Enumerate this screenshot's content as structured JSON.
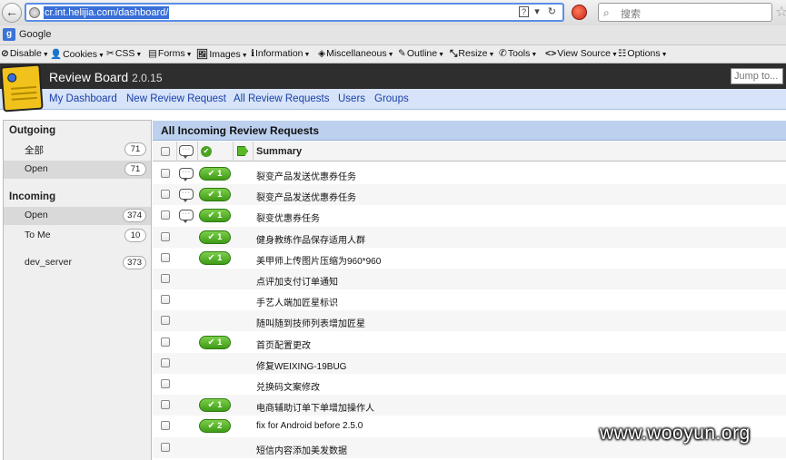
{
  "browser": {
    "url": "cr.int.helijia.com/dashboard/",
    "search_placeholder": "搜索",
    "url_tools": "▾ ↻"
  },
  "bookmarks": [
    {
      "label": "Google"
    }
  ],
  "devbar": [
    {
      "glyph": "⊘",
      "label": "Disable"
    },
    {
      "glyph": "👤",
      "label": "Cookies"
    },
    {
      "glyph": "✂",
      "label": "CSS"
    },
    {
      "glyph": "▤",
      "label": "Forms"
    },
    {
      "glyph": "🖼",
      "label": "Images"
    },
    {
      "glyph": "ℹ",
      "label": "Information"
    },
    {
      "glyph": "◈",
      "label": "Miscellaneous"
    },
    {
      "glyph": "✎",
      "label": "Outline"
    },
    {
      "glyph": "⤡",
      "label": "Resize"
    },
    {
      "glyph": "✆",
      "label": "Tools"
    },
    {
      "glyph": "<>",
      "label": "View Source"
    },
    {
      "glyph": "☷",
      "label": "Options"
    }
  ],
  "header": {
    "title": "Review Board",
    "version": "2.0.15",
    "jump_placeholder": "Jump to..."
  },
  "nav": [
    {
      "label": "My Dashboard"
    },
    {
      "label": "New Review Request"
    },
    {
      "label": "All Review Requests"
    },
    {
      "label": "Users"
    },
    {
      "label": "Groups"
    }
  ],
  "sidebar": {
    "outgoing_heading": "Outgoing",
    "outgoing": [
      {
        "label": "全部",
        "count": "71"
      },
      {
        "label": "Open",
        "count": "71"
      }
    ],
    "incoming_heading": "Incoming",
    "incoming": [
      {
        "label": "Open",
        "count": "374"
      },
      {
        "label": "To Me",
        "count": "10"
      },
      {
        "label": "dev_server",
        "count": "373"
      }
    ]
  },
  "main": {
    "title": "All Incoming Review Requests",
    "summary_header": "Summary",
    "rows": [
      {
        "comments": true,
        "ship": "✔ 1",
        "summary": "裂变产品发送优惠券任务"
      },
      {
        "comments": true,
        "ship": "✔ 1",
        "summary": "裂变产品发送优惠券任务"
      },
      {
        "comments": true,
        "ship": "✔ 1",
        "summary": "裂变优惠券任务"
      },
      {
        "comments": false,
        "ship": "✔ 1",
        "summary": "健身教练作品保存适用人群"
      },
      {
        "comments": false,
        "ship": "✔ 1",
        "summary": "美甲师上传图片压缩为960*960"
      },
      {
        "comments": false,
        "ship": "",
        "summary": "点评加支付订单通知"
      },
      {
        "comments": false,
        "ship": "",
        "summary": "手艺人端加匠星标识"
      },
      {
        "comments": false,
        "ship": "",
        "summary": "随叫随到技师列表增加匠星"
      },
      {
        "comments": false,
        "ship": "✔ 1",
        "summary": "首页配置更改"
      },
      {
        "comments": false,
        "ship": "",
        "summary": "修复WEIXING-19BUG"
      },
      {
        "comments": false,
        "ship": "",
        "summary": "兑换码文案修改"
      },
      {
        "comments": false,
        "ship": "✔ 1",
        "summary": "电商辅助订单下单增加操作人"
      },
      {
        "comments": false,
        "ship": "✔ 2",
        "summary": "fix for Android before 2.5.0"
      },
      {
        "comments": false,
        "ship": "",
        "summary": "短信内容添加美发数据"
      }
    ]
  },
  "watermark": "www.wooyun.org"
}
